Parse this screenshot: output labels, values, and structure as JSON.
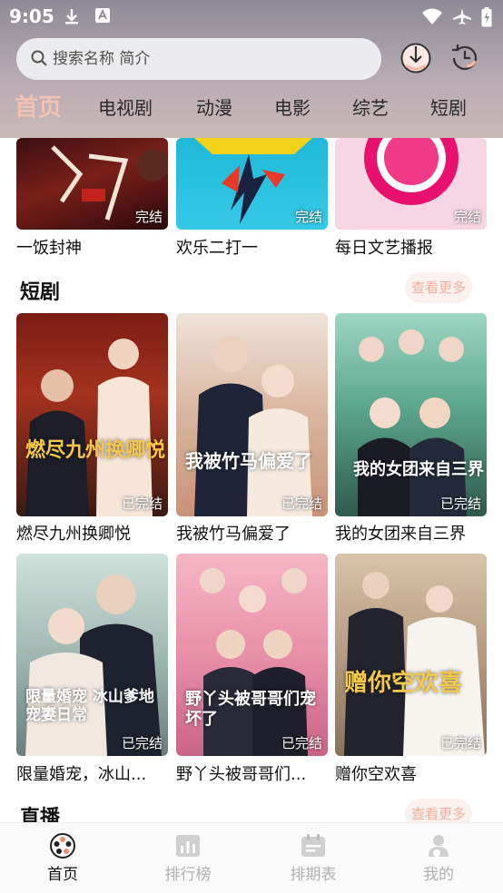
{
  "status_bar": {
    "time": "9:05"
  },
  "search": {
    "placeholder": "搜索名称 简介"
  },
  "tabs": [
    {
      "label": "首页"
    },
    {
      "label": "电视剧"
    },
    {
      "label": "动漫"
    },
    {
      "label": "电影"
    },
    {
      "label": "综艺"
    },
    {
      "label": "短剧"
    }
  ],
  "top_row": [
    {
      "title": "一饭封神",
      "badge": "完结"
    },
    {
      "title": "欢乐二打一",
      "badge": "完结"
    },
    {
      "title": "每日文艺播报",
      "badge": "完结"
    }
  ],
  "short_drama": {
    "heading": "短剧",
    "more": "查看更多",
    "items": [
      {
        "title": "燃尽九州换卿悦",
        "badge": "已完结",
        "poster_text": "燃尽九州换卿悦"
      },
      {
        "title": "我被竹马偏爱了",
        "badge": "已完结",
        "poster_text": "我被竹马偏爱了"
      },
      {
        "title": "我的女团来自三界",
        "badge": "已完结",
        "poster_text": "我的女团来自三界"
      },
      {
        "title": "限量婚宠，冰山...",
        "badge": "已完结",
        "poster_text": "限量婚宠 冰山爹地宠妻日常"
      },
      {
        "title": "野丫头被哥哥们...",
        "badge": "已完结",
        "poster_text": "野丫头被哥哥们宠坏了"
      },
      {
        "title": "赠你空欢喜",
        "badge": "已完结",
        "poster_text": "赠你空欢喜"
      }
    ]
  },
  "live": {
    "heading": "直播",
    "more": "查看更多"
  },
  "bottom_nav": [
    {
      "label": "首页",
      "icon": "film-reel-icon"
    },
    {
      "label": "排行榜",
      "icon": "chart-icon"
    },
    {
      "label": "排期表",
      "icon": "calendar-icon"
    },
    {
      "label": "我的",
      "icon": "profile-icon"
    }
  ],
  "colors": {
    "accent": "#f0c2b2",
    "more_bg": "#fbf1ee",
    "more_text": "#f0b0a0"
  }
}
